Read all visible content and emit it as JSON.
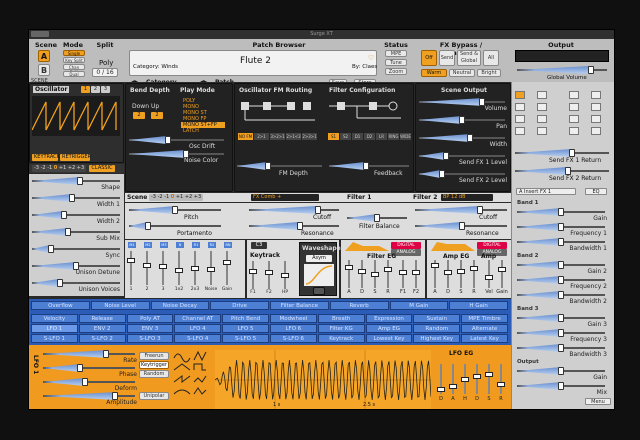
{
  "window": {
    "title": "Surge XT"
  },
  "header": {
    "scene_label": "Scene",
    "scene_a": "A",
    "scene_b": "B",
    "mode_label": "Mode",
    "mode_opts": [
      "Single",
      "Key Split",
      "Chan Split",
      "Dual"
    ],
    "split_label": "Split",
    "poly_label": "Poly",
    "poly_count": "0 / 16",
    "patch_browser_label": "Patch Browser",
    "category": "Category: Winds",
    "patch_name": "Flute 2",
    "author": "By: Claes",
    "category_nav": "Category",
    "patch_nav": "Patch",
    "save": "Save",
    "store": "Store",
    "status_label": "Status",
    "status_btns": [
      "MPE",
      "Tune",
      "Zoom"
    ],
    "fx_label": "FX Bypass / Character",
    "fx_opts": [
      "Off",
      "Send",
      "Send & Global",
      "All"
    ],
    "character": [
      "Warm",
      "Neutral",
      "Bright"
    ],
    "output_label": "Output",
    "global_volume": "Global Volume",
    "global_volume_level": 0.8
  },
  "scene_tag": "SCENE",
  "osc": {
    "title": "Oscillator",
    "nums": [
      "1",
      "2",
      "3"
    ],
    "keytrack": "KEYTRACK",
    "retrigger": "RETRIGGER",
    "pitch_vals": [
      "-3",
      "-2",
      "-1",
      "0",
      "+1",
      "+2",
      "+3"
    ],
    "classic": "CLASSIC",
    "params": [
      "Shape",
      "Width 1",
      "Width 2",
      "Sub Mix",
      "Sync",
      "Unison Detune",
      "Unison Voices"
    ],
    "levels": [
      0.55,
      0.45,
      0.35,
      0.4,
      0.2,
      0.5,
      0.3
    ]
  },
  "bend": {
    "title": "Bend Depth",
    "down": "Down",
    "up": "Up",
    "down_val": "2",
    "up_val": "2"
  },
  "play_mode": {
    "title": "Play Mode",
    "opts": [
      "POLY",
      "MONO",
      "MONO ST",
      "MONO FP",
      "MONO ST+FP",
      "LATCH"
    ]
  },
  "osc_drift": "Osc Drift",
  "noise_color": "Noise Color",
  "fm": {
    "title": "Oscillator FM Routing",
    "depth": "FM Depth",
    "routes": [
      "NO FM",
      "2>1",
      "3>2>1",
      "2>1<3",
      "2>3>1"
    ]
  },
  "filter_cfg": {
    "title": "Filter Configuration",
    "feedback": "Feedback",
    "routes": [
      "S1",
      "S2",
      "D1",
      "D2",
      "LR",
      "RING",
      "WIDE"
    ]
  },
  "scene_output": {
    "title": "Scene Output",
    "params": [
      "Volume",
      "Pan",
      "Width",
      "Send FX 1 Level",
      "Send FX 2 Level"
    ],
    "levels": [
      0.75,
      0.5,
      0.6,
      0.3,
      0.25
    ]
  },
  "scene_row": {
    "label": "Scene",
    "vals": [
      "-3",
      "-2",
      "-1",
      "0",
      "+1",
      "+2",
      "+3"
    ],
    "pitch": "Pitch",
    "portamento": "Portamento",
    "osc": "OSC",
    "ring": "RING"
  },
  "filter1": {
    "type": "FX Comb +",
    "label": "Filter 1",
    "cutoff": "Cutoff",
    "resonance": "Resonance"
  },
  "filter2": {
    "label": "Filter 2",
    "type": "BP 12 dB",
    "cutoff": "Cutoff",
    "resonance": "Resonance"
  },
  "filter_balance": "Filter Balance",
  "mixer": {
    "labels": [
      "M1",
      "M2",
      "M3",
      "N",
      "R1",
      "R2",
      "RN"
    ],
    "bottom": [
      "1",
      "2",
      "3",
      "1x2",
      "2x3",
      "Noise",
      "Gain"
    ]
  },
  "c3": "C3",
  "keytrack": "Keytrack",
  "waveshaper": "Waveshaper",
  "asym": "Asym",
  "kt_labels": [
    "F1",
    "F2",
    "HP"
  ],
  "filter_eg": {
    "title": "Filter EG",
    "tag1": "DIGITAL",
    "tag2": "ANALOG",
    "adsr": [
      "A",
      "D",
      "S",
      "R"
    ],
    "f1": "F1",
    "f2": "F2"
  },
  "amp_eg": {
    "title": "Amp EG",
    "amp": "Amp",
    "tag1": "DIGITAL",
    "tag2": "ANALOG",
    "adsr": [
      "A",
      "D",
      "S",
      "R"
    ],
    "velgain": [
      "Vel",
      "Gain"
    ]
  },
  "fx_panel": {
    "slot": "A Insert FX 1",
    "type": "EQ",
    "groups": [
      {
        "name": "Band 1",
        "params": [
          "Gain",
          "Frequency 1",
          "Bandwidth 1"
        ]
      },
      {
        "name": "Band 2",
        "params": [
          "Gain 2",
          "Frequency 2",
          "Bandwidth 2"
        ]
      },
      {
        "name": "Band 3",
        "params": [
          "Gain 3",
          "Frequency 3",
          "Bandwidth 3"
        ]
      },
      {
        "name": "Output",
        "params": [
          "Gain",
          "Mix"
        ]
      }
    ],
    "sends": [
      "Send FX 1 Return",
      "Send FX 2 Return"
    ],
    "menu": "Menu"
  },
  "mod_macros": [
    "Overflow",
    "Noise Level",
    "Noise Decay",
    "Drive",
    "Filter Balance",
    "Reverb",
    "M Gain",
    "H Gain"
  ],
  "mod_row2": [
    "Velocity",
    "Release Velocity",
    "Poly AT",
    "Channel AT",
    "Pitch Bend",
    "Modwheel",
    "Breath",
    "Expression",
    "Sustain",
    "MPE Timbre"
  ],
  "mod_row3": [
    "LFO 1",
    "ENV 2",
    "ENV 3",
    "LFO 4",
    "LFO 5",
    "LFO 6",
    "Filter KG",
    "Amp EG",
    "Random",
    "Alternate"
  ],
  "mod_row4": [
    "S-LFO 1",
    "S-LFO 2",
    "S-LFO 3",
    "S-LFO 4",
    "S-LFO 5",
    "S-LFO 6",
    "Keytrack",
    "Lowest Key",
    "Highest Key",
    "Latest Key"
  ],
  "lfo": {
    "side": "LFO 1",
    "params": [
      "Rate",
      "Phase",
      "Deform",
      "Amplitude"
    ],
    "buttons": [
      "Freerun",
      "Keytrigger",
      "Random"
    ],
    "unipolar": "Unipolar",
    "eg_title": "LFO EG",
    "eg_labels": [
      "D",
      "A",
      "H",
      "D",
      "S",
      "R"
    ],
    "time_labels": [
      "1 s",
      "2.5 s"
    ]
  }
}
